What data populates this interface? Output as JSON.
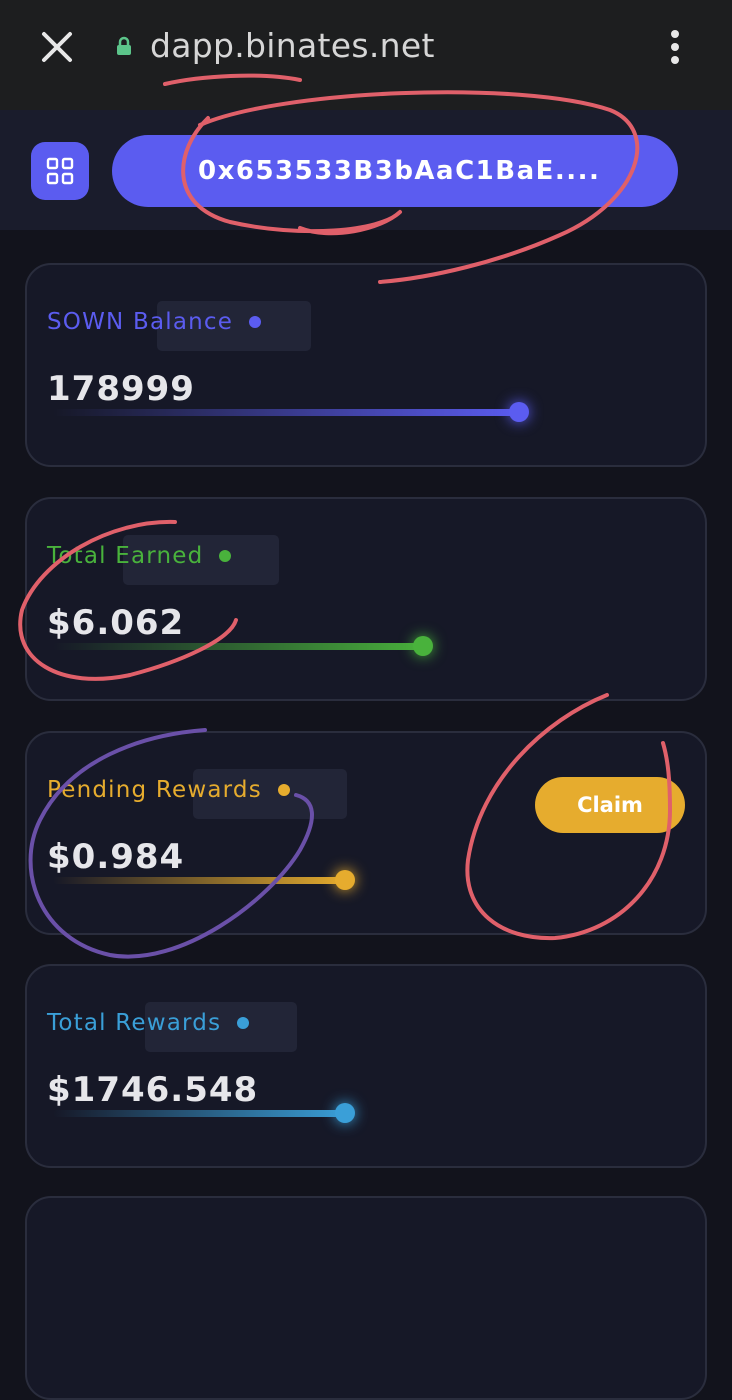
{
  "browser": {
    "url": "dapp.binates.net"
  },
  "header": {
    "address": "0x653533B3bAaC1BaE...."
  },
  "cards": [
    {
      "label": "SOWN Balance",
      "value": "178999",
      "color": "#5b5cf0"
    },
    {
      "label": "Total Earned",
      "value": "$6.062",
      "color": "#49b23c"
    },
    {
      "label": "Pending Rewards",
      "value": "$0.984",
      "color": "#e6ac2e",
      "claim_label": "Claim"
    },
    {
      "label": "Total Rewards",
      "value": "$1746.548",
      "color": "#3a9fd8"
    }
  ],
  "colors": {
    "accent": "#5b5cf0",
    "annotation_red": "#e0606a",
    "annotation_purple": "#6a50a8"
  }
}
